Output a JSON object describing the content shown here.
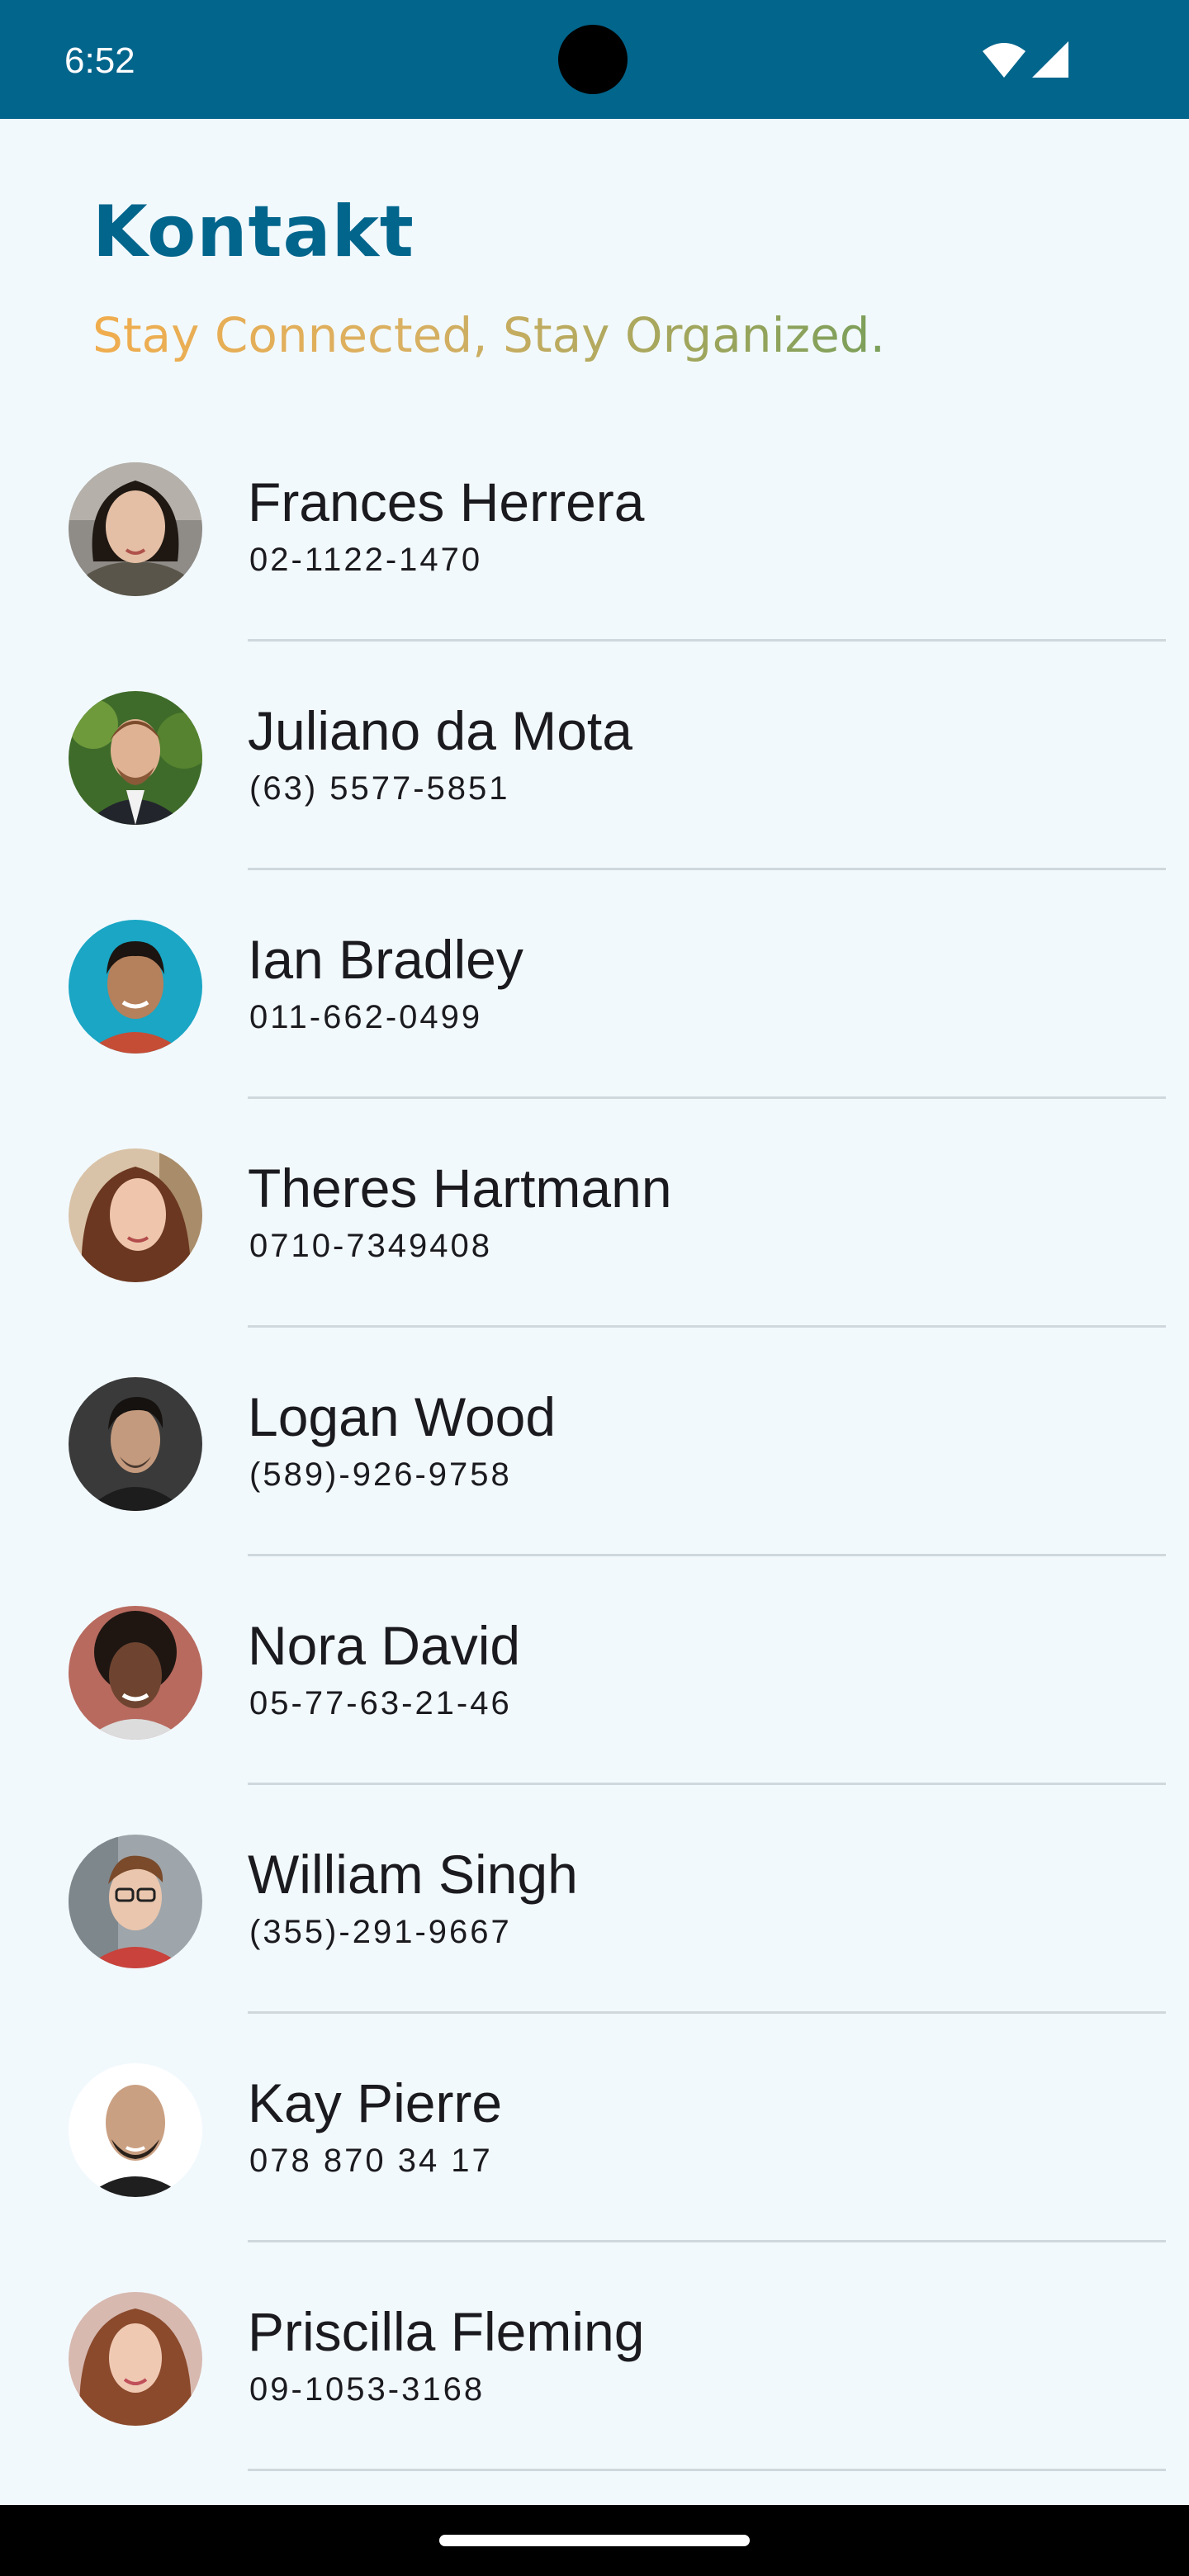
{
  "status_bar": {
    "time": "6:52"
  },
  "header": {
    "title": "Kontakt",
    "tagline": "Stay Connected, Stay Organized."
  },
  "colors": {
    "brand": "#02658c",
    "background": "#f2f9fd",
    "tagline_start": "#f0ad4e",
    "tagline_end": "#7a9f5a",
    "divider": "#cfd8dc"
  },
  "contacts": [
    {
      "name": "Frances Herrera",
      "phone": "02-1122-1470",
      "avatar_icon": "avatar-photo"
    },
    {
      "name": "Juliano da Mota",
      "phone": "(63) 5577-5851",
      "avatar_icon": "avatar-photo"
    },
    {
      "name": "Ian Bradley",
      "phone": "011-662-0499",
      "avatar_icon": "avatar-photo"
    },
    {
      "name": "Theres Hartmann",
      "phone": "0710-7349408",
      "avatar_icon": "avatar-photo"
    },
    {
      "name": "Logan Wood",
      "phone": "(589)-926-9758",
      "avatar_icon": "avatar-photo"
    },
    {
      "name": "Nora David",
      "phone": "05-77-63-21-46",
      "avatar_icon": "avatar-photo"
    },
    {
      "name": "William Singh",
      "phone": "(355)-291-9667",
      "avatar_icon": "avatar-photo"
    },
    {
      "name": "Kay Pierre",
      "phone": "078 870 34 17",
      "avatar_icon": "avatar-photo"
    },
    {
      "name": "Priscilla Fleming",
      "phone": "09-1053-3168",
      "avatar_icon": "avatar-photo"
    }
  ]
}
